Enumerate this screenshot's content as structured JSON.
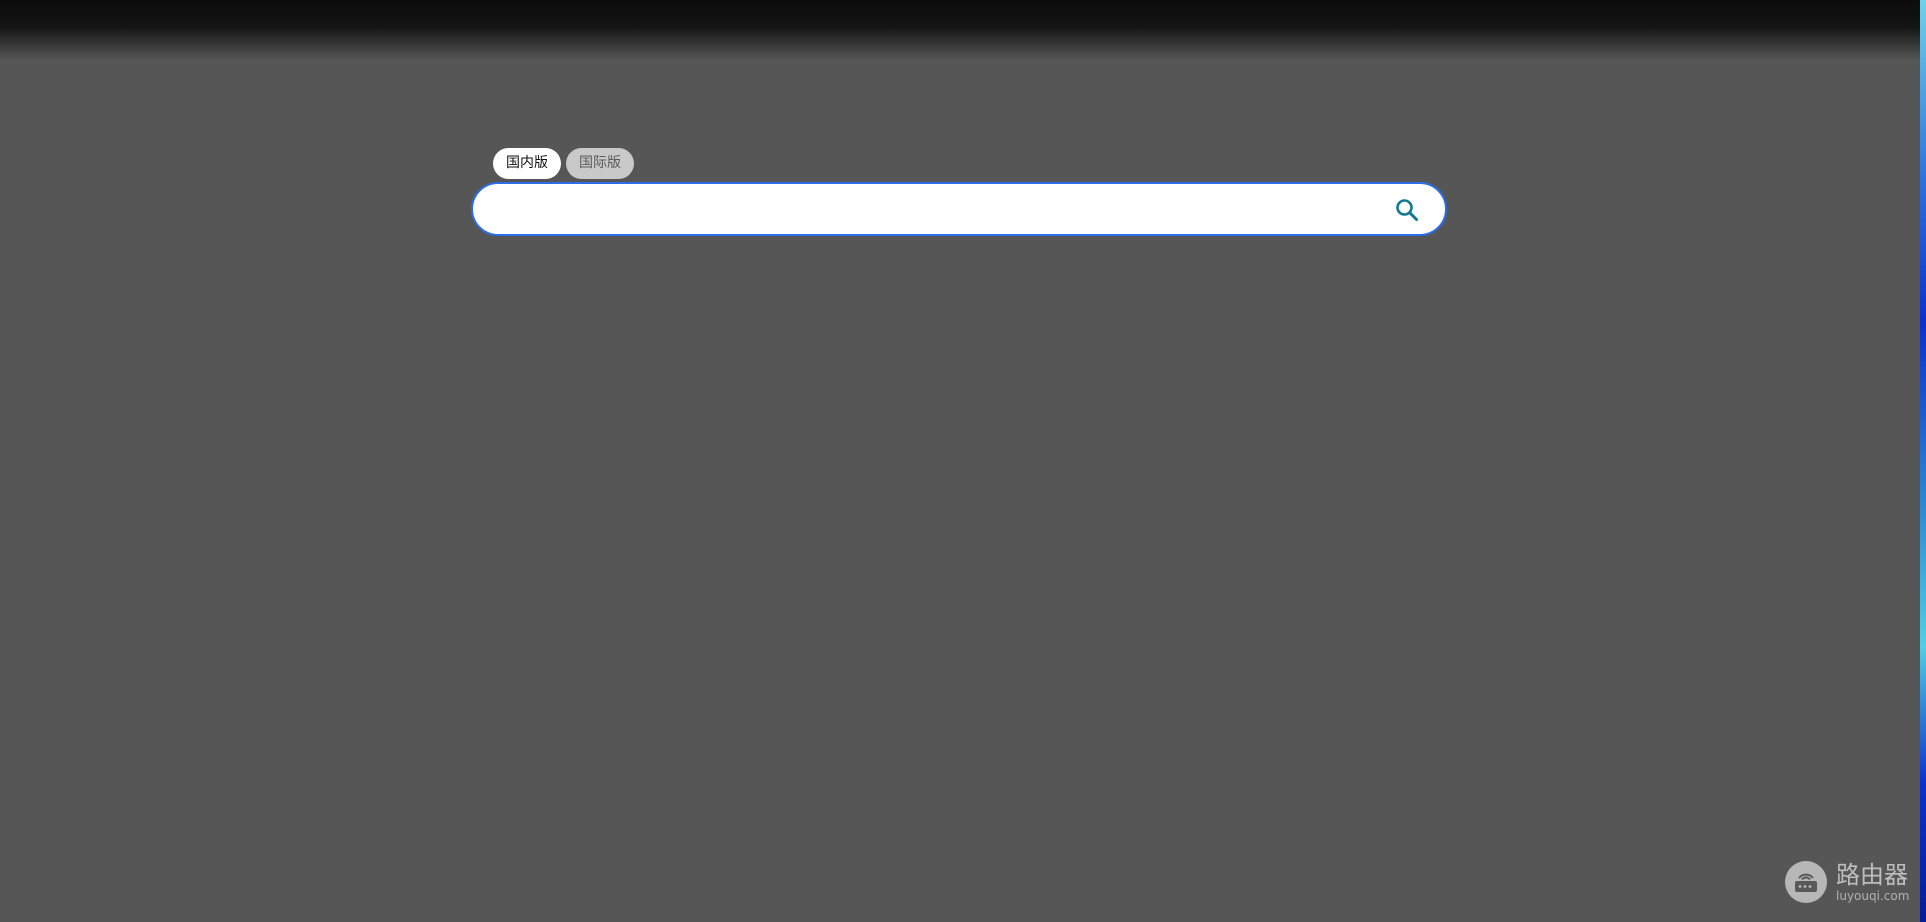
{
  "tabs": [
    {
      "label": "国内版",
      "active": true
    },
    {
      "label": "国际版",
      "active": false
    }
  ],
  "search": {
    "value": "",
    "placeholder": "",
    "icon": "search-icon"
  },
  "watermark": {
    "title": "路由器",
    "subtitle": "luyouqi.com",
    "icon": "router-logo-icon"
  },
  "colors": {
    "background": "#565656",
    "search_border": "#2c6ee6",
    "search_icon": "#137a93",
    "tab_active_bg": "#ffffff",
    "tab_inactive_bg": "#c9c9c9"
  }
}
